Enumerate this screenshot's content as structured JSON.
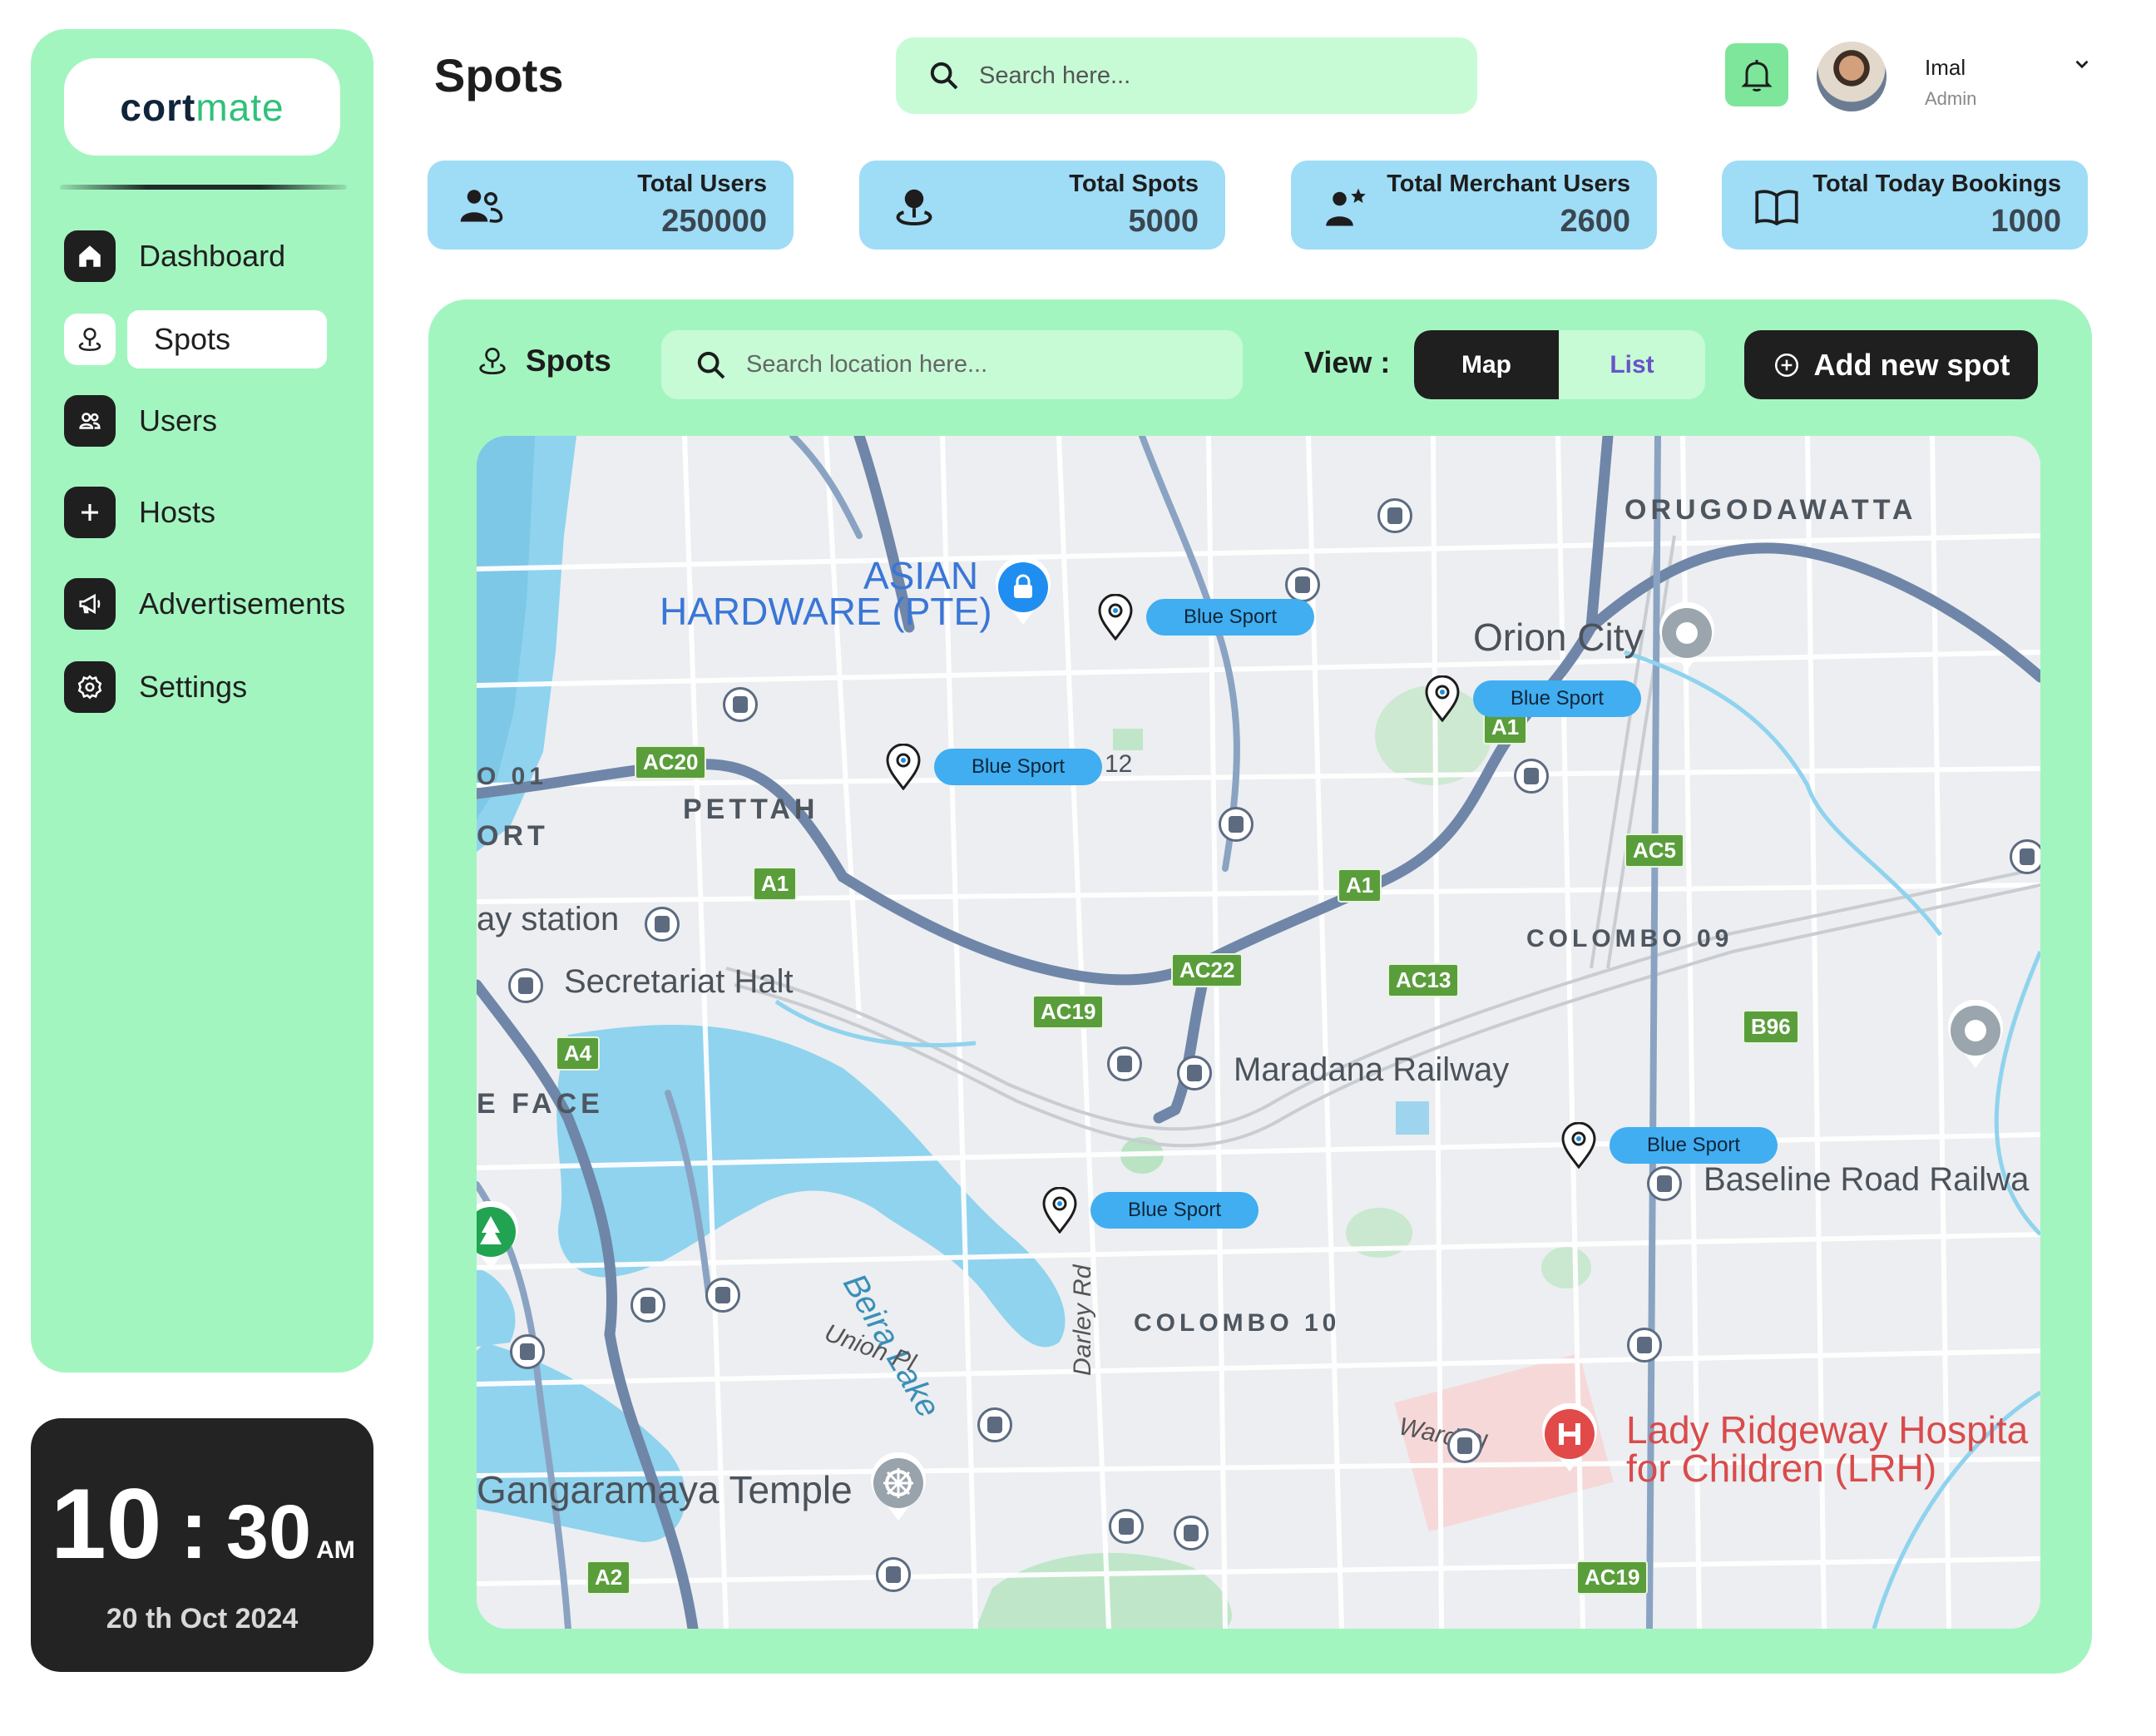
{
  "brand": {
    "logo_part1": "cort",
    "logo_part2": "mate"
  },
  "sidebar": {
    "items": [
      {
        "label": "Dashboard",
        "icon": "home-icon"
      },
      {
        "label": "Spots",
        "icon": "location-person-icon",
        "active": true
      },
      {
        "label": "Users",
        "icon": "users-icon"
      },
      {
        "label": "Hosts",
        "icon": "plus-icon"
      },
      {
        "label": "Advertisements",
        "icon": "megaphone-icon"
      },
      {
        "label": "Settings",
        "icon": "gear-icon"
      }
    ]
  },
  "clock": {
    "hours": "10",
    "colon": ":",
    "minutes": "30",
    "ampm": "AM",
    "date": "20 th Oct 2024"
  },
  "header": {
    "title": "Spots",
    "search_placeholder": "Search here...",
    "user_name": "Imal",
    "user_role": "Admin"
  },
  "stats": [
    {
      "title": "Total Users",
      "value": "250000",
      "icon": "users-icon"
    },
    {
      "title": "Total Spots",
      "value": "5000",
      "icon": "location-person-icon"
    },
    {
      "title": "Total Merchant Users",
      "value": "2600",
      "icon": "merchant-star-icon"
    },
    {
      "title": "Total Today Bookings",
      "value": "1000",
      "icon": "open-book-icon"
    }
  ],
  "panel": {
    "title": "Spots",
    "search_placeholder": "Search location here...",
    "view_label": "View :",
    "view_options": [
      "Map",
      "List"
    ],
    "view_selected": "Map",
    "add_button": "Add new spot"
  },
  "map": {
    "districts": [
      "ORUGODAWATTA",
      "PETTAH",
      "COLOMBO 09",
      "COLOMBO 10",
      "E FACE",
      "O 01",
      "ORT"
    ],
    "places": [
      "Orion City",
      "Secretariat Halt",
      "Maradana Railway",
      "Baseline Road Railwa",
      "Gangaramaya Temple",
      "ay station",
      "12"
    ],
    "poi_blue": [
      "ASIAN",
      "HARDWARE (PTE)"
    ],
    "poi_red": [
      "Lady Ridgeway Hospita",
      "for Children (LRH)"
    ],
    "roads": [
      "Beira Lake",
      "Union Pl",
      "Darley Rd",
      "Ward Pl"
    ],
    "shields": [
      "AC20",
      "A1",
      "A1",
      "A1",
      "AC5",
      "AC22",
      "AC13",
      "AC19",
      "A4",
      "B96",
      "A2",
      "AC19"
    ],
    "spot_tags": [
      "Blue Sport",
      "Blue Sport",
      "Blue Sport",
      "Blue Sport",
      "Blue Sport"
    ]
  },
  "colors": {
    "accent": "#a3f5c0",
    "card": "#9fdcf6",
    "dark": "#1f1f1f",
    "tag": "#40aef0",
    "water": "#8fd3ee"
  }
}
